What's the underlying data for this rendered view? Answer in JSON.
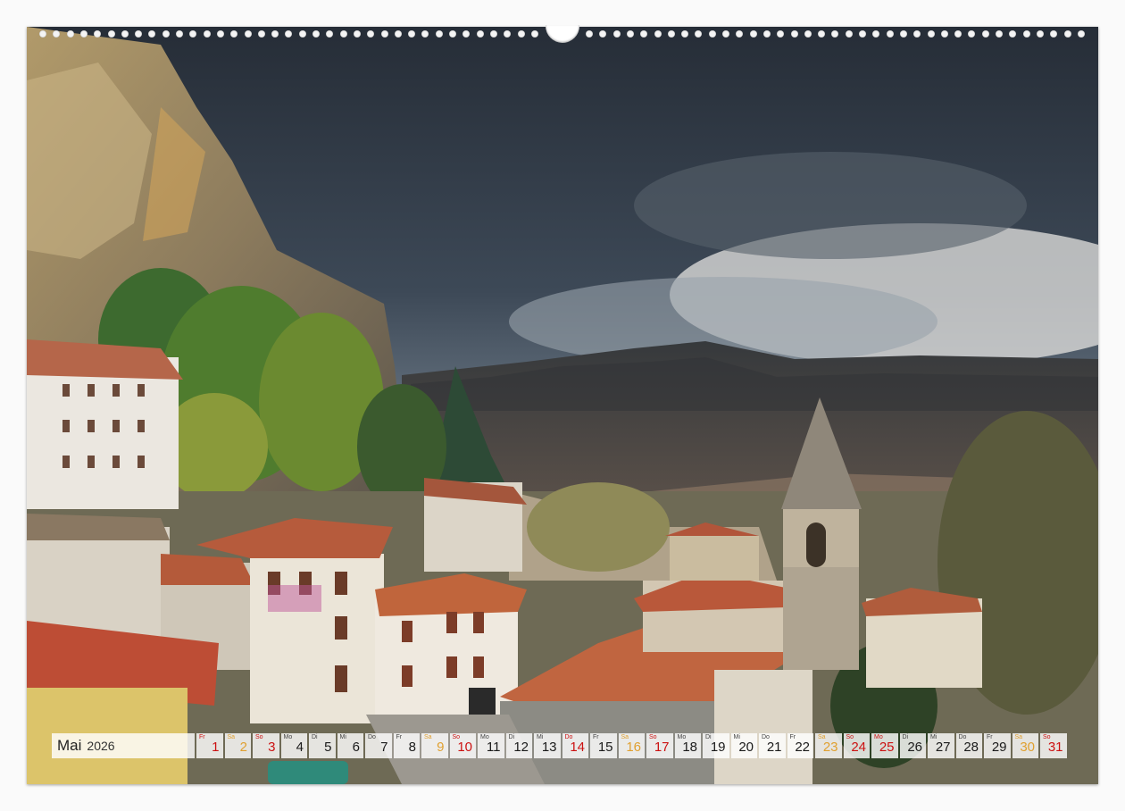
{
  "calendar": {
    "month": "Mai",
    "year": "2026",
    "days": [
      {
        "wd": "Fr",
        "num": "1",
        "type": "sun"
      },
      {
        "wd": "Sa",
        "num": "2",
        "type": "sat"
      },
      {
        "wd": "So",
        "num": "3",
        "type": "sun"
      },
      {
        "wd": "Mo",
        "num": "4",
        "type": "work"
      },
      {
        "wd": "Di",
        "num": "5",
        "type": "work"
      },
      {
        "wd": "Mi",
        "num": "6",
        "type": "work"
      },
      {
        "wd": "Do",
        "num": "7",
        "type": "work"
      },
      {
        "wd": "Fr",
        "num": "8",
        "type": "work"
      },
      {
        "wd": "Sa",
        "num": "9",
        "type": "sat"
      },
      {
        "wd": "So",
        "num": "10",
        "type": "sun"
      },
      {
        "wd": "Mo",
        "num": "11",
        "type": "work"
      },
      {
        "wd": "Di",
        "num": "12",
        "type": "work"
      },
      {
        "wd": "Mi",
        "num": "13",
        "type": "work"
      },
      {
        "wd": "Do",
        "num": "14",
        "type": "sun"
      },
      {
        "wd": "Fr",
        "num": "15",
        "type": "work"
      },
      {
        "wd": "Sa",
        "num": "16",
        "type": "sat"
      },
      {
        "wd": "So",
        "num": "17",
        "type": "sun"
      },
      {
        "wd": "Mo",
        "num": "18",
        "type": "work"
      },
      {
        "wd": "Di",
        "num": "19",
        "type": "work"
      },
      {
        "wd": "Mi",
        "num": "20",
        "type": "work"
      },
      {
        "wd": "Do",
        "num": "21",
        "type": "work"
      },
      {
        "wd": "Fr",
        "num": "22",
        "type": "work"
      },
      {
        "wd": "Sa",
        "num": "23",
        "type": "sat"
      },
      {
        "wd": "So",
        "num": "24",
        "type": "sun"
      },
      {
        "wd": "Mo",
        "num": "25",
        "type": "sun"
      },
      {
        "wd": "Di",
        "num": "26",
        "type": "work"
      },
      {
        "wd": "Mi",
        "num": "27",
        "type": "work"
      },
      {
        "wd": "Do",
        "num": "28",
        "type": "work"
      },
      {
        "wd": "Fr",
        "num": "29",
        "type": "work"
      },
      {
        "wd": "Sa",
        "num": "30",
        "type": "sat"
      },
      {
        "wd": "So",
        "num": "31",
        "type": "sun"
      }
    ]
  },
  "colors": {
    "sunday_holiday": "#cc1111",
    "saturday": "#e0a030",
    "weekday": "#1a1a1a"
  }
}
